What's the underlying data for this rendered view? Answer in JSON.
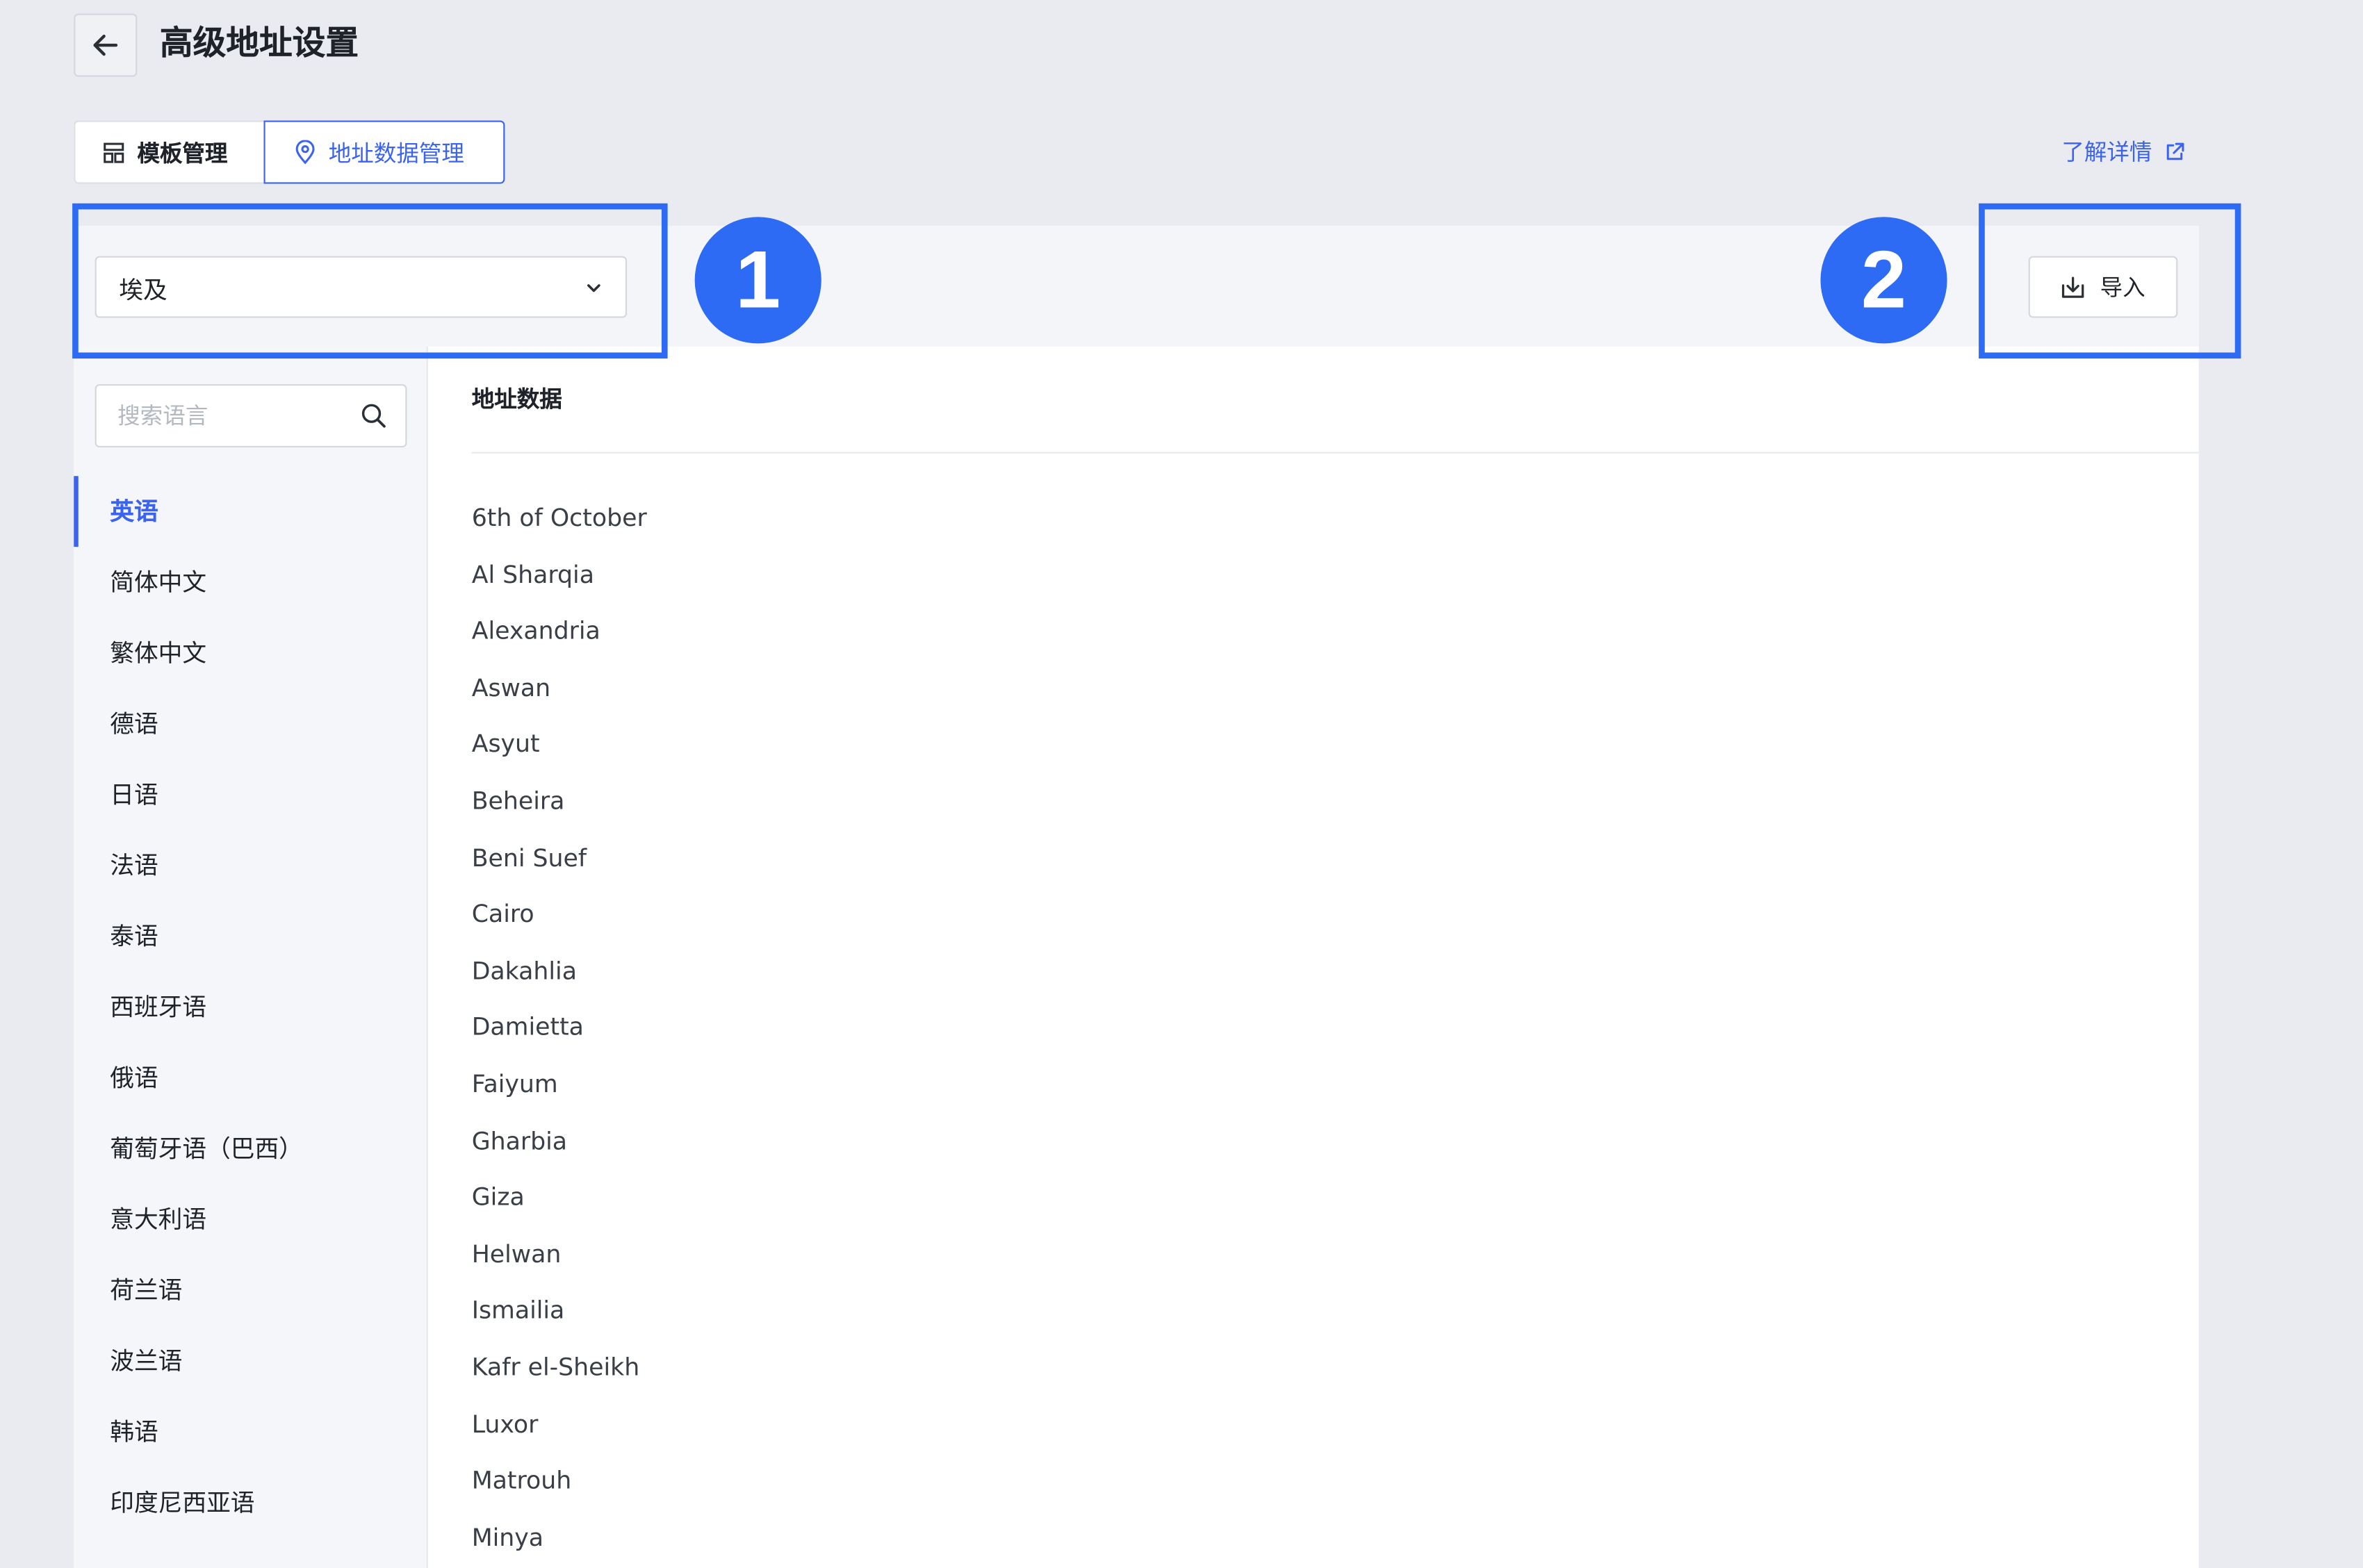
{
  "header": {
    "title": "高级地址设置"
  },
  "tabs": [
    {
      "label": "模板管理",
      "active": false
    },
    {
      "label": "地址数据管理",
      "active": true
    }
  ],
  "learn_more": {
    "label": "了解详情"
  },
  "toolbar": {
    "country_select": {
      "value": "埃及"
    },
    "import_label": "导入"
  },
  "callouts": [
    "1",
    "2"
  ],
  "sidebar": {
    "search": {
      "placeholder": "搜索语言",
      "value": ""
    },
    "languages": [
      {
        "label": "英语",
        "active": true
      },
      {
        "label": "简体中文"
      },
      {
        "label": "繁体中文"
      },
      {
        "label": "德语"
      },
      {
        "label": "日语"
      },
      {
        "label": "法语"
      },
      {
        "label": "泰语"
      },
      {
        "label": "西班牙语"
      },
      {
        "label": "俄语"
      },
      {
        "label": "葡萄牙语（巴西）"
      },
      {
        "label": "意大利语"
      },
      {
        "label": "荷兰语"
      },
      {
        "label": "波兰语"
      },
      {
        "label": "韩语"
      },
      {
        "label": "印度尼西亚语"
      }
    ]
  },
  "content": {
    "heading": "地址数据",
    "items": [
      "6th of October",
      "Al Sharqia",
      "Alexandria",
      "Aswan",
      "Asyut",
      "Beheira",
      "Beni Suef",
      "Cairo",
      "Dakahlia",
      "Damietta",
      "Faiyum",
      "Gharbia",
      "Giza",
      "Helwan",
      "Ismailia",
      "Kafr el-Sheikh",
      "Luxor",
      "Matrouh",
      "Minya"
    ]
  },
  "colors": {
    "accent": "#3b63ee",
    "callout": "#2e6bf5",
    "page_background": "#e9ebf0"
  },
  "icons": {
    "back": "arrow-left-icon",
    "template_tab": "layout-icon",
    "address_tab": "location-pin-icon",
    "external": "external-link-icon",
    "dropdown": "chevron-down-icon",
    "import": "download-icon",
    "search": "search-icon"
  }
}
